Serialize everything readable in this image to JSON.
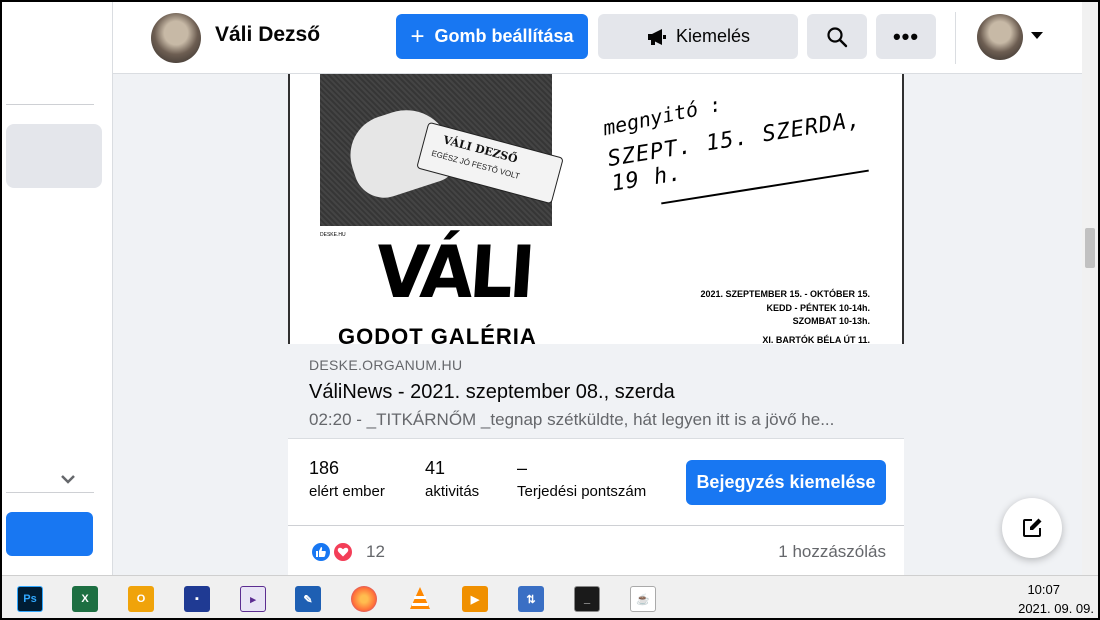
{
  "topbar": {
    "page_name": "Váli Dezső",
    "setup_button_label": "Gomb beállítása",
    "boost_button_label": "Kiemelés"
  },
  "poster": {
    "photo_tag_name": "VÁLI DEZSŐ",
    "photo_tag_sub": "EGÉSZ JÓ FESTŐ VOLT",
    "credit": "DESKE.HU",
    "title": "VÁLI",
    "gallery": "GODOT GALÉRIA",
    "handwritten_line1": "megnyitó :",
    "handwritten_line2": "SZEPT. 15. SZERDA, 19 h.",
    "info_lines": [
      "2021. SZEPTEMBER 15. - OKTÓBER 15.",
      "KEDD - PÉNTEK 10-14h.",
      "SZOMBAT 10-13h.",
      "XI. BARTÓK BÉLA ÚT 11."
    ]
  },
  "link_preview": {
    "domain": "DESKE.ORGANUM.HU",
    "title": "VáliNews - 2021. szeptember 08., szerda",
    "description": "02:20 - _TITKÁRNŐM _tegnap szétküldte, hát legyen itt is a jövő he..."
  },
  "stats": {
    "reach_value": "186",
    "reach_label": "elért ember",
    "engagement_value": "41",
    "engagement_label": "aktivitás",
    "distribution_value": "–",
    "distribution_label": "Terjedési pontszám",
    "promote_button_label": "Bejegyzés kiemelése"
  },
  "reactions": {
    "count": "12",
    "comments": "1 hozzászólás"
  },
  "taskbar": {
    "apps": [
      "photoshop-icon",
      "excel-icon",
      "outlook-icon",
      "save-icon",
      "visual-studio-icon",
      "paint-icon",
      "firefox-icon",
      "vlc-icon",
      "media-player-icon",
      "network-icon",
      "terminal-icon",
      "java-icon"
    ],
    "time": "10:07",
    "date": "2021. 09. 09."
  },
  "colors": {
    "accent": "#1877f2",
    "background": "#f0f2f5",
    "love": "#f33e58"
  }
}
